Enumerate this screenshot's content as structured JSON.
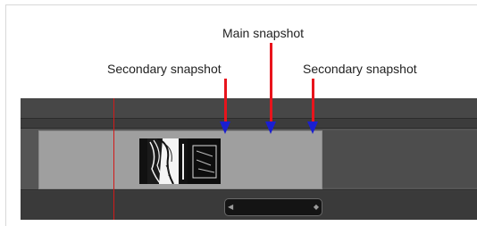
{
  "annotations": {
    "main": "Main snapshot",
    "secondary_left": "Secondary snapshot",
    "secondary_right": "Secondary snapshot"
  },
  "colors": {
    "arrow": "#e8141c",
    "snapshot_marker": "#1a1fd0",
    "playhead": "#d21a1a",
    "timeline_bg": "#3f3f3f",
    "clip": "#9f9f9f"
  },
  "icons": {
    "snapshot_marker": "triangle-down",
    "scrollbar_left_cap": "triangle-left",
    "scrollbar_right_cap": "diamond"
  }
}
